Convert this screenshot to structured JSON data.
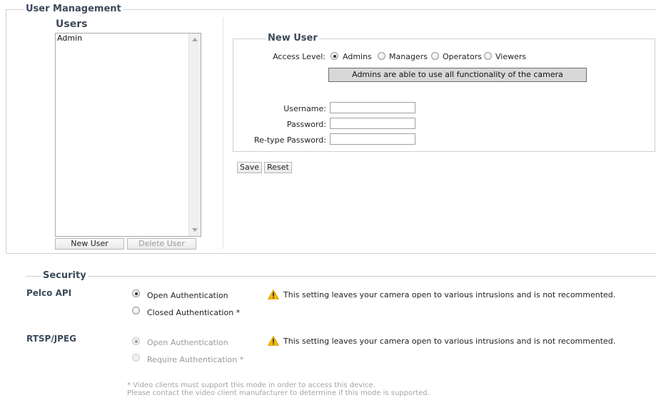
{
  "user_management": {
    "legend": "User Management",
    "users_heading": "Users",
    "users": [
      "Admin"
    ],
    "new_user_button": "New User",
    "delete_user_button": "Delete User"
  },
  "new_user": {
    "legend": "New User",
    "access_level_label": "Access Level:",
    "access_levels": [
      {
        "label": "Admins",
        "checked": true
      },
      {
        "label": "Managers",
        "checked": false
      },
      {
        "label": "Operators",
        "checked": false
      },
      {
        "label": "Viewers",
        "checked": false
      }
    ],
    "description": "Admins are able to use all functionality of the camera",
    "username_label": "Username:",
    "username_value": "",
    "password_label": "Password:",
    "password_value": "",
    "retype_label": "Re-type Password:",
    "retype_value": "",
    "save_button": "Save",
    "reset_button": "Reset"
  },
  "security": {
    "legend": "Security",
    "pelco": {
      "name": "Pelco API",
      "open_label": "Open Authentication",
      "closed_label": "Closed Authentication *",
      "selected": "open",
      "warning": "This setting leaves your camera open to various intrusions and is not recommented."
    },
    "rtsp": {
      "name": "RTSP/JPEG",
      "open_label": "Open Authentication",
      "require_label": "Require Authentication *",
      "selected": "open",
      "disabled": true,
      "warning": "This setting leaves your camera open to various intrusions and is not recommented."
    },
    "note_line1": "* Video clients must support this mode in order to access this device.",
    "note_line2": "Please contact the video client manufacturer to determine if this mode is supported."
  },
  "colors": {
    "heading": "#3c4a5a",
    "warning_fill": "#f5b800"
  },
  "icons": {
    "warning": "warning-triangle-icon",
    "scroll_up": "scroll-up-arrow-icon",
    "scroll_down": "scroll-down-arrow-icon"
  }
}
